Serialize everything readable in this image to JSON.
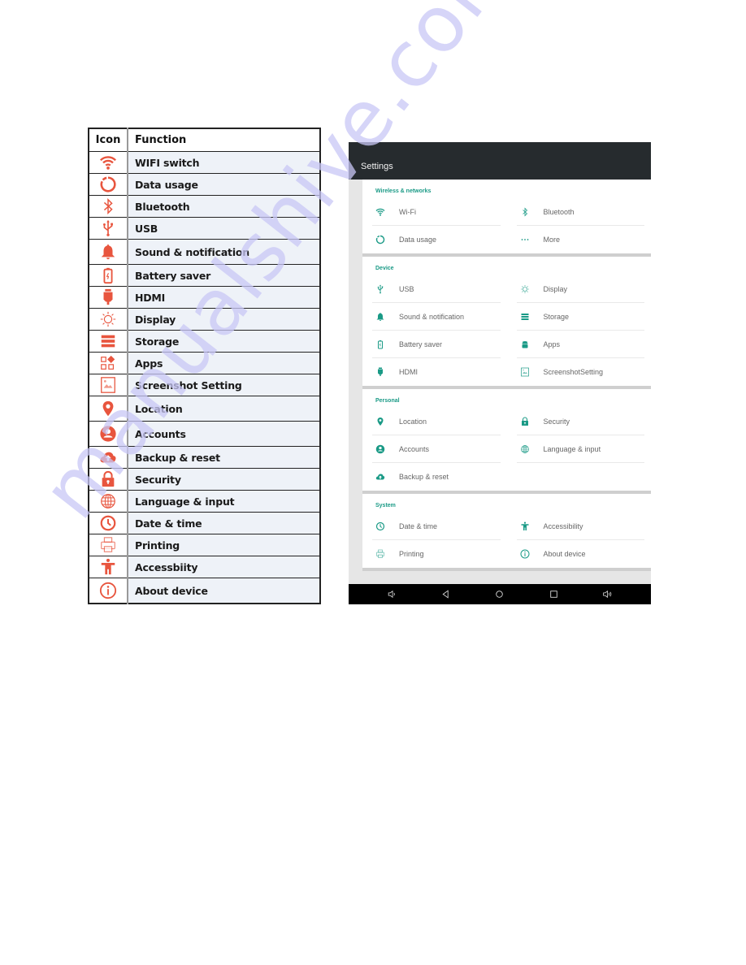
{
  "table": {
    "headers": {
      "icon": "Icon",
      "function": "Function"
    },
    "rows": [
      {
        "icon": "wifi-icon",
        "function": "WIFI switch"
      },
      {
        "icon": "data-usage-icon",
        "function": "Data usage"
      },
      {
        "icon": "bluetooth-icon",
        "function": "Bluetooth"
      },
      {
        "icon": "usb-icon",
        "function": "USB"
      },
      {
        "icon": "bell-icon",
        "function": "Sound & notification"
      },
      {
        "icon": "battery-icon",
        "function": "Battery saver"
      },
      {
        "icon": "hdmi-icon",
        "function": "HDMI"
      },
      {
        "icon": "brightness-icon",
        "function": "Display"
      },
      {
        "icon": "storage-icon",
        "function": "Storage"
      },
      {
        "icon": "apps-icon",
        "function": "Apps"
      },
      {
        "icon": "screenshot-icon",
        "function": "Screenshot Setting"
      },
      {
        "icon": "location-icon",
        "function": "Location"
      },
      {
        "icon": "account-icon",
        "function": "Accounts"
      },
      {
        "icon": "cloud-upload-icon",
        "function": "Backup & reset"
      },
      {
        "icon": "lock-icon",
        "function": "Security"
      },
      {
        "icon": "globe-icon",
        "function": "Language & input"
      },
      {
        "icon": "clock-icon",
        "function": "Date & time"
      },
      {
        "icon": "printer-icon",
        "function": "Printing"
      },
      {
        "icon": "accessibility-icon",
        "function": "Accessbiity"
      },
      {
        "icon": "info-icon",
        "function": "About device"
      }
    ],
    "icon_color": "#e8553e"
  },
  "android": {
    "title": "Settings",
    "accent_color": "#1a9a86",
    "sections": [
      {
        "header": "Wireless & networks",
        "items": [
          {
            "icon": "wifi-icon",
            "label": "Wi-Fi"
          },
          {
            "icon": "bluetooth-icon",
            "label": "Bluetooth"
          },
          {
            "icon": "data-usage-icon",
            "label": "Data usage"
          },
          {
            "icon": "more-icon",
            "label": "More"
          }
        ]
      },
      {
        "header": "Device",
        "items": [
          {
            "icon": "usb-icon",
            "label": "USB"
          },
          {
            "icon": "brightness-icon",
            "label": "Display"
          },
          {
            "icon": "bell-icon",
            "label": "Sound & notification"
          },
          {
            "icon": "storage-icon",
            "label": "Storage"
          },
          {
            "icon": "battery-icon",
            "label": "Battery saver"
          },
          {
            "icon": "android-icon",
            "label": "Apps"
          },
          {
            "icon": "hdmi-icon",
            "label": "HDMI"
          },
          {
            "icon": "screenshot-icon",
            "label": "ScreenshotSetting"
          }
        ]
      },
      {
        "header": "Personal",
        "items": [
          {
            "icon": "location-icon",
            "label": "Location"
          },
          {
            "icon": "lock-icon",
            "label": "Security"
          },
          {
            "icon": "account-icon",
            "label": "Accounts"
          },
          {
            "icon": "globe-icon",
            "label": "Language & input"
          },
          {
            "icon": "cloud-upload-icon",
            "label": "Backup & reset"
          }
        ]
      },
      {
        "header": "System",
        "items": [
          {
            "icon": "clock-icon",
            "label": "Date & time"
          },
          {
            "icon": "accessibility-icon",
            "label": "Accessibility"
          },
          {
            "icon": "printer-icon",
            "label": "Printing"
          },
          {
            "icon": "info-icon",
            "label": "About device"
          }
        ]
      }
    ],
    "navbar": [
      "volume-down-icon",
      "back-icon",
      "home-icon",
      "recents-icon",
      "volume-up-icon"
    ]
  },
  "watermark": "manualshive.com"
}
